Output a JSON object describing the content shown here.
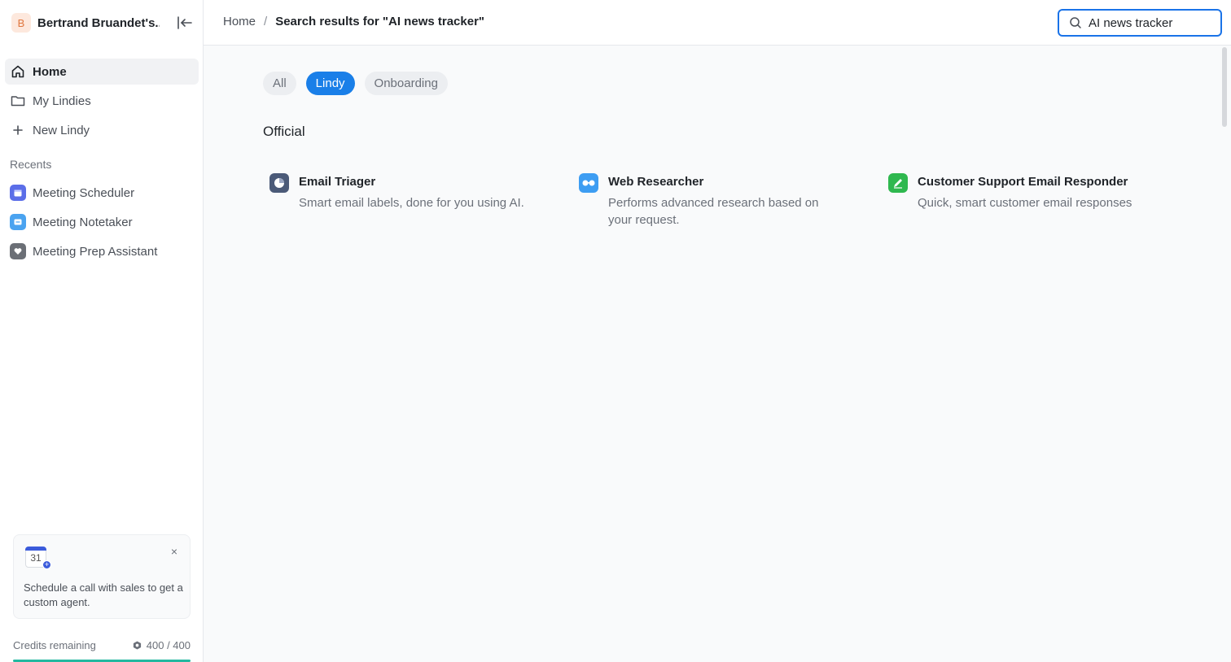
{
  "workspace": {
    "avatar_letter": "B",
    "name": "Bertrand Bruandet's..."
  },
  "nav": [
    {
      "label": "Home",
      "icon": "home-icon",
      "active": true
    },
    {
      "label": "My Lindies",
      "icon": "folder-icon",
      "active": false
    },
    {
      "label": "New Lindy",
      "icon": "plus-icon",
      "active": false
    }
  ],
  "recents": {
    "title": "Recents",
    "items": [
      {
        "label": "Meeting Scheduler",
        "icon": "calendar-icon",
        "color": "#5b6ee8"
      },
      {
        "label": "Meeting Notetaker",
        "icon": "notes-icon",
        "color": "#4aa3f0"
      },
      {
        "label": "Meeting Prep Assistant",
        "icon": "heart-icon",
        "color": "#6b6f76"
      }
    ]
  },
  "promo": {
    "calendar_day": "31",
    "text": "Schedule a call with sales to get a custom agent."
  },
  "credits": {
    "label": "Credits remaining",
    "value": "400 / 400",
    "fraction": 1.0
  },
  "breadcrumb": {
    "home": "Home",
    "separator": "/",
    "current": "Search results for \"AI news tracker\""
  },
  "search": {
    "value": "AI news tracker"
  },
  "filters": [
    {
      "label": "All",
      "selected": false
    },
    {
      "label": "Lindy",
      "selected": true
    },
    {
      "label": "Onboarding",
      "selected": false
    }
  ],
  "section": {
    "title": "Official"
  },
  "cards": [
    {
      "title": "Email Triager",
      "description": "Smart email labels, done for you using AI.",
      "icon": "pie-chart-icon",
      "color": "#4b5a78"
    },
    {
      "title": "Web Researcher",
      "description": "Performs advanced research based on your request.",
      "icon": "glasses-icon",
      "color": "#3d9df2"
    },
    {
      "title": "Customer Support Email Responder",
      "description": "Quick, smart customer email responses",
      "icon": "pencil-icon",
      "color": "#2fb84f"
    }
  ],
  "colors": {
    "accent": "#1a7fe8",
    "search_border": "#1a73e8",
    "credit_bar": "#22b8a0"
  }
}
